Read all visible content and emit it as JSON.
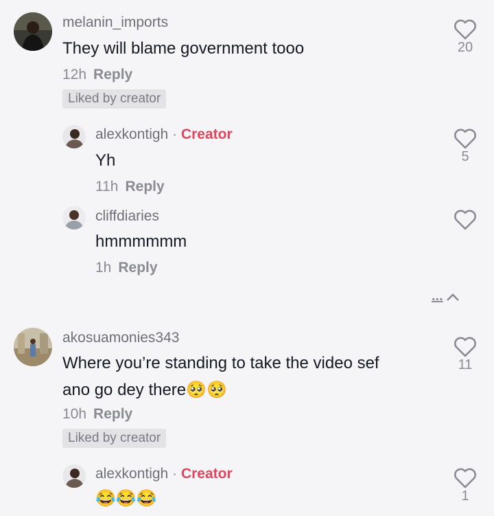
{
  "comments": [
    {
      "username": "melanin_imports",
      "text": "They will blame government tooo",
      "time": "12h",
      "reply_label": "Reply",
      "badge": "Liked by creator",
      "likes": "20"
    },
    {
      "username": "alexkontigh",
      "separator": "·",
      "creator_label": "Creator",
      "text": "Yh",
      "time": "11h",
      "reply_label": "Reply",
      "likes": "5"
    },
    {
      "username": "cliffdiaries",
      "text": "hmmmmmm",
      "time": "1h",
      "reply_label": "Reply",
      "likes": ""
    },
    {
      "username": "akosuamonies343",
      "text_line1": "Where you’re standing to take the video sef",
      "text_line2": "ano go dey there",
      "text_line2_emoji": "🥺🥺",
      "time": "10h",
      "reply_label": "Reply",
      "badge": "Liked by creator",
      "likes": "11"
    },
    {
      "username": "alexkontigh",
      "separator": "·",
      "creator_label": "Creator",
      "text": "😂😂😂",
      "likes": "1"
    }
  ],
  "collapse_control": {
    "label": "...",
    "icon": "chevron-up-icon"
  },
  "icons": {
    "like": "heart-outline-icon"
  },
  "colors": {
    "creator": "#e0465e",
    "background": "#f5f4f6"
  }
}
